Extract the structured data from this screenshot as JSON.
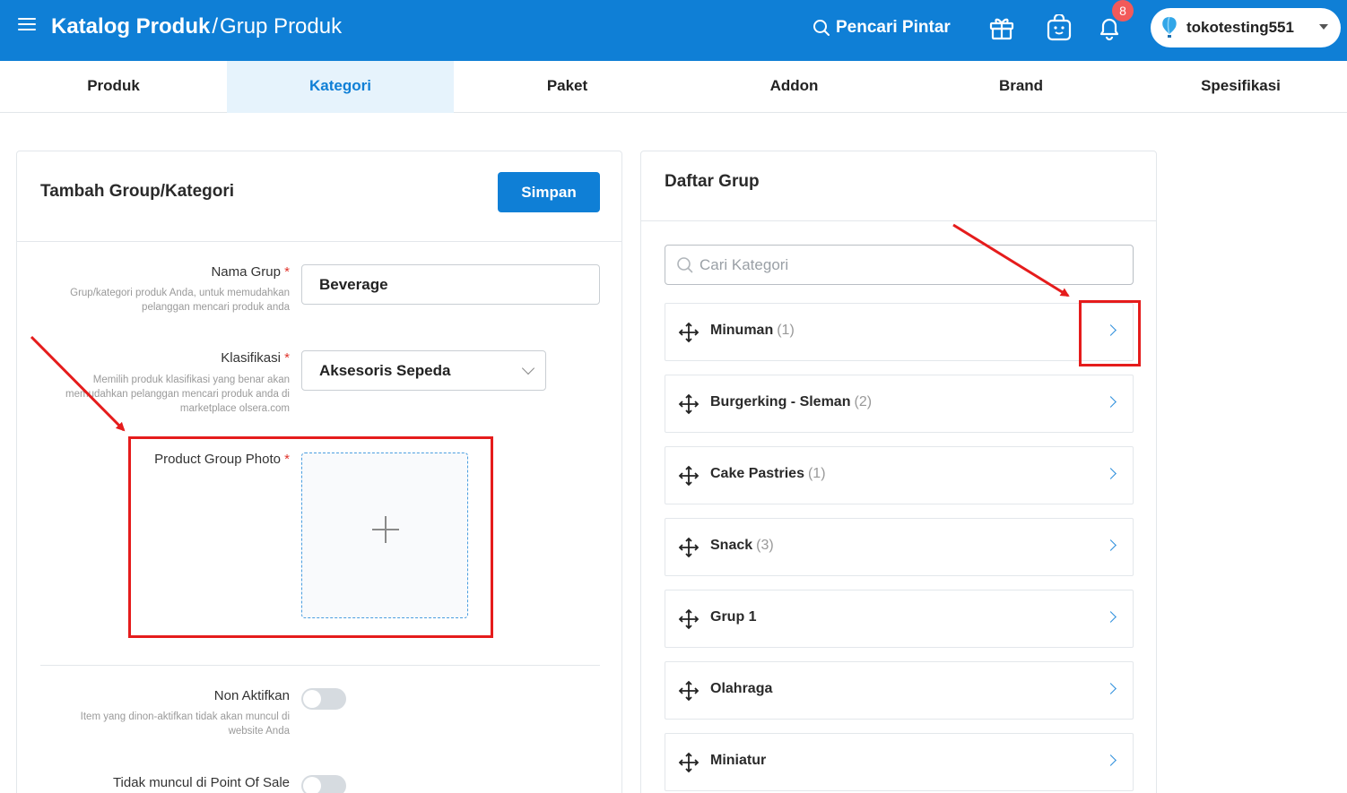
{
  "header": {
    "title_main": "Katalog Produk",
    "title_separator": "/",
    "title_sub": "Grup Produk",
    "smart_search_label": "Pencari Pintar",
    "notification_count": "8",
    "store_name": "tokotesting551",
    "bg_color": "#0f7fd6"
  },
  "tabs": [
    {
      "label": "Produk",
      "active": false
    },
    {
      "label": "Kategori",
      "active": true
    },
    {
      "label": "Paket",
      "active": false
    },
    {
      "label": "Addon",
      "active": false
    },
    {
      "label": "Brand",
      "active": false
    },
    {
      "label": "Spesifikasi",
      "active": false
    }
  ],
  "form": {
    "title": "Tambah Group/Kategori",
    "save_label": "Simpan",
    "nama_grup": {
      "label": "Nama Grup",
      "required_mark": "*",
      "help_line1": "Grup/kategori produk Anda, untuk memudahkan",
      "help_line2": "pelanggan mencari produk anda",
      "value": "Beverage"
    },
    "klasifikasi": {
      "label": "Klasifikasi",
      "required_mark": "*",
      "help_line1": "Memilih produk klasifikasi yang benar akan",
      "help_line2": "memudahkan pelanggan mencari produk anda di",
      "help_line3": "marketplace olsera.com",
      "value": "Aksesoris Sepeda"
    },
    "photo": {
      "label": "Product Group Photo",
      "required_mark": "*"
    },
    "non_aktifkan": {
      "label": "Non Aktifkan",
      "help_line1": "Item yang dinon-aktifkan tidak akan muncul di",
      "help_line2": "website Anda"
    },
    "pos": {
      "label": "Tidak muncul di Point Of Sale"
    }
  },
  "group_list": {
    "title": "Daftar Grup",
    "search_placeholder": "Cari Kategori",
    "items": [
      {
        "name": "Minuman",
        "count": "(1)"
      },
      {
        "name": "Burgerking - Sleman",
        "count": "(2)"
      },
      {
        "name": "Cake Pastries",
        "count": "(1)"
      },
      {
        "name": "Snack",
        "count": "(3)"
      },
      {
        "name": "Grup 1",
        "count": ""
      },
      {
        "name": "Olahraga",
        "count": ""
      },
      {
        "name": "Miniatur",
        "count": ""
      }
    ]
  },
  "annotation_color": "#e51c1c",
  "accent_color": "#0f7fd6"
}
